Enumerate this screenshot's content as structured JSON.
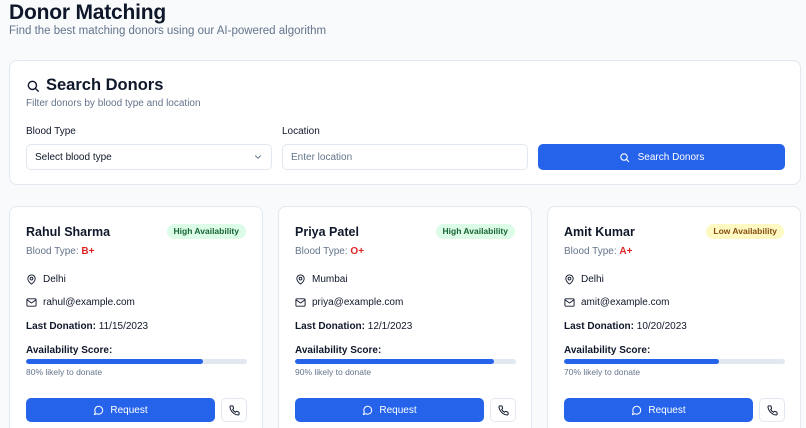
{
  "header": {
    "title": "Donor Matching",
    "subtitle": "Find the best matching donors using our AI-powered algorithm"
  },
  "search": {
    "title": "Search Donors",
    "description": "Filter donors by blood type and location",
    "blood_type_label": "Blood Type",
    "blood_type_value": "Select blood type",
    "location_label": "Location",
    "location_placeholder": "Enter location",
    "button_label": "Search Donors"
  },
  "labels": {
    "blood_type_prefix": "Blood Type: ",
    "last_donation_prefix": "Last Donation:",
    "availability_score": "Availability Score:",
    "request_button": "Request"
  },
  "donors": [
    {
      "name": "Rahul Sharma",
      "availability": "High Availability",
      "blood_type": "B+",
      "location": "Delhi",
      "email": "rahul@example.com",
      "last_donation": "11/15/2023",
      "score": 80,
      "score_text": "80% likely to donate"
    },
    {
      "name": "Priya Patel",
      "availability": "High Availability",
      "blood_type": "O+",
      "location": "Mumbai",
      "email": "priya@example.com",
      "last_donation": "12/1/2023",
      "score": 90,
      "score_text": "90% likely to donate"
    },
    {
      "name": "Amit Kumar",
      "availability": "Low Availability",
      "blood_type": "A+",
      "location": "Delhi",
      "email": "amit@example.com",
      "last_donation": "10/20/2023",
      "score": 70,
      "score_text": "70% likely to donate"
    }
  ],
  "colors": {
    "primary": "#2563eb",
    "blood_type": "#dc2626",
    "badge_high_bg": "#dcfce7",
    "badge_high_text": "#166534",
    "badge_low_bg": "#fef9c3",
    "badge_low_text": "#854d0e"
  },
  "icons": {
    "search": "search-icon",
    "select": "chevron-down-icon",
    "location": "map-pin-icon",
    "email": "mail-icon",
    "request": "message-circle-icon",
    "call": "phone-icon"
  }
}
